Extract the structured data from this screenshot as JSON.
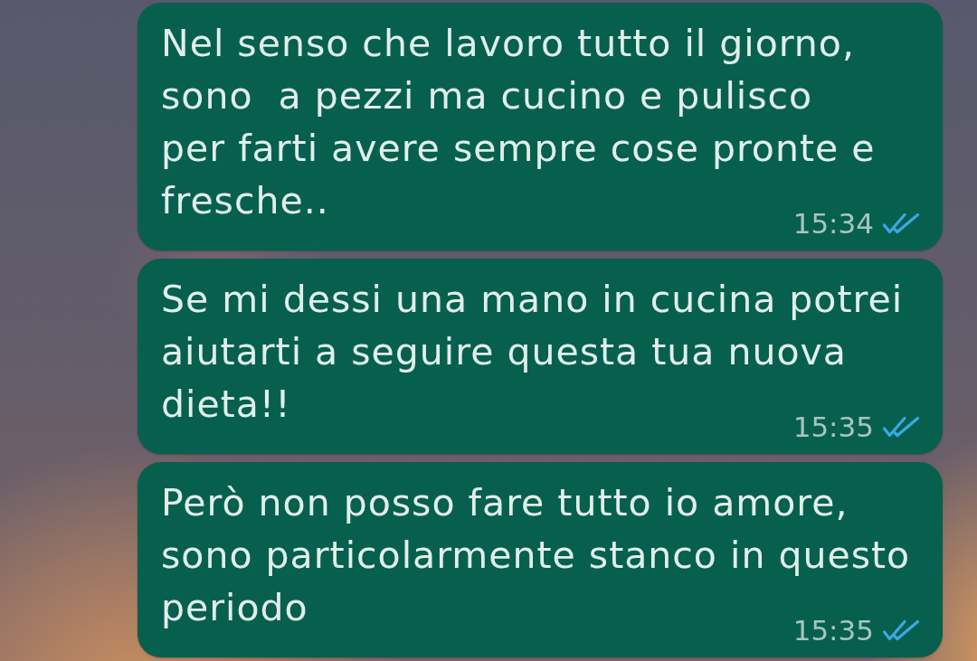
{
  "messages": [
    {
      "text": "Nel senso che lavoro tutto il giorno, sono  a pezzi ma cucino e pulisco\nper farti avere sempre cose pronte e fresche..",
      "time": "15:34",
      "read": true
    },
    {
      "text": "Se mi dessi una mano in cucina potrei aiutarti a seguire questa tua nuova dieta!!",
      "time": "15:35",
      "read": true
    },
    {
      "text": "Però non posso fare tutto io amore, sono particolarmente stanco in questo periodo",
      "time": "15:35",
      "read": true
    }
  ]
}
